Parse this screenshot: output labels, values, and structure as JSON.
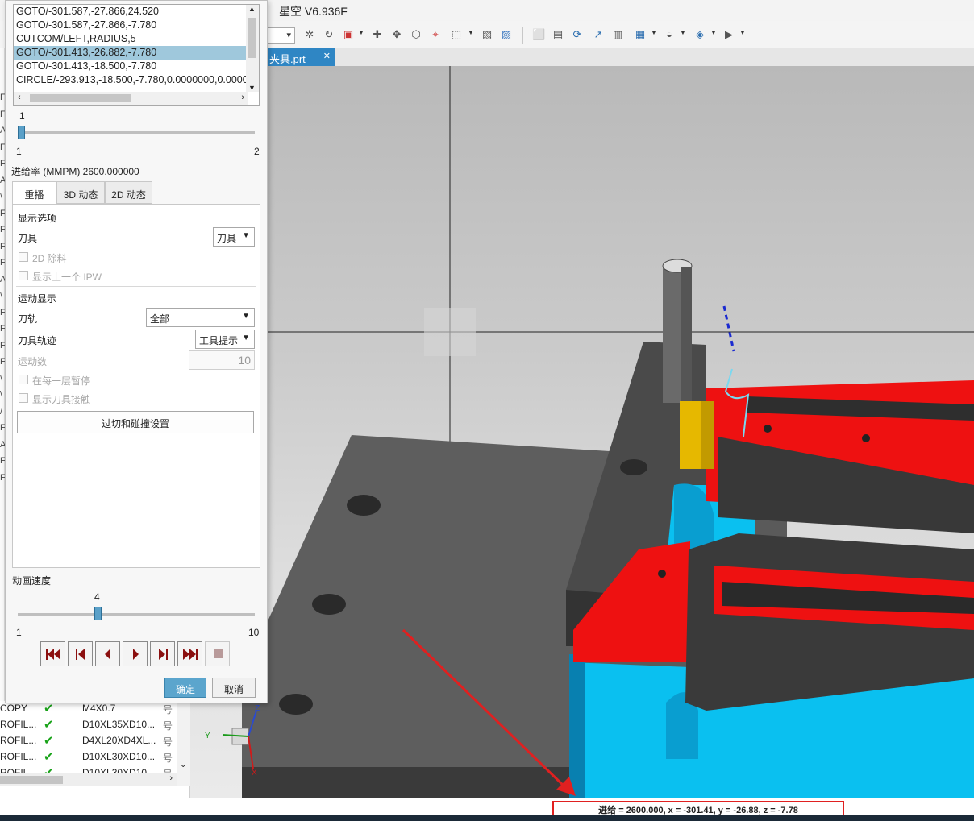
{
  "window": {
    "title": "星空 V6.936F"
  },
  "file_tab": {
    "label": "夹具.prt",
    "close": "✕"
  },
  "path_list": {
    "rows": [
      "GOTO/-301.587,-27.866,24.520",
      "GOTO/-301.587,-27.866,-7.780",
      "CUTCOM/LEFT,RADIUS,5",
      "GOTO/-301.413,-26.882,-7.780",
      "GOTO/-301.413,-18.500,-7.780",
      "CIRCLE/-293.913,-18.500,-7.780,0.0000000,0.0000"
    ],
    "selected_index": 3
  },
  "step_slider": {
    "value": "1",
    "min": "1",
    "max": "2",
    "position": 0
  },
  "feed_rate": "进给率 (MMPM) 2600.000000",
  "tabs": [
    "重播",
    "3D 动态",
    "2D 动态"
  ],
  "active_tab": 0,
  "replay": {
    "display_options_header": "显示选项",
    "tool_label": "刀具",
    "tool_value": "刀具",
    "chk_2d_removal": "2D 除料",
    "chk_show_prev_ipw": "显示上一个 IPW",
    "motion_display_header": "运动显示",
    "path_label": "刀轨",
    "path_value": "全部",
    "tool_trace_label": "刀具轨迹",
    "tool_trace_value": "工具提示",
    "motion_count_label": "运动数",
    "motion_count_value": "10",
    "chk_pause_each_layer": "在每一层暂停",
    "chk_show_tool_contact": "显示刀具接触",
    "gouge_button": "过切和碰撞设置"
  },
  "anim_speed": {
    "label": "动画速度",
    "value": "4",
    "min": "1",
    "max": "10",
    "position": 0.333
  },
  "playback_buttons": [
    "jump-to-start",
    "step-back",
    "play-backward",
    "play-forward",
    "step-forward",
    "jump-to-end",
    "stop"
  ],
  "dialog_buttons": {
    "ok": "确定",
    "cancel": "取消"
  },
  "navigator_rows": [
    {
      "name": "COPY",
      "tool": "M4X0.7",
      "extra": "号"
    },
    {
      "name": "ROFIL...",
      "tool": "D10XL35XD10...",
      "extra": "号"
    },
    {
      "name": "ROFIL...",
      "tool": "D4XL20XD4XL...",
      "extra": "号"
    },
    {
      "name": "ROFIL...",
      "tool": "D10XL30XD10...",
      "extra": "号"
    },
    {
      "name": "ROFIL...",
      "tool": "D10XL30XD10...",
      "extra": "号"
    }
  ],
  "left_strip_letters": [
    "F",
    "F",
    "A",
    "F",
    "F",
    "A",
    "\\",
    "F",
    "F",
    "F",
    "F",
    "A",
    "\\",
    "F",
    "F",
    "F",
    "F",
    "\\",
    "\\",
    "/",
    "F",
    "A",
    "F",
    "F"
  ],
  "status": "进给 = 2600.000, x = -301.41, y = -26.88, z = -7.78",
  "triad_labels": {
    "z": "Z",
    "y": "Y",
    "x": "X"
  },
  "colors": {
    "accent": "#5ba5cd",
    "selection": "#9fc8dc",
    "status_box": "#e02020",
    "part_red": "#ee1111",
    "part_cyan": "#0ac0f0",
    "fixture_gray": "#5c5c5c"
  }
}
